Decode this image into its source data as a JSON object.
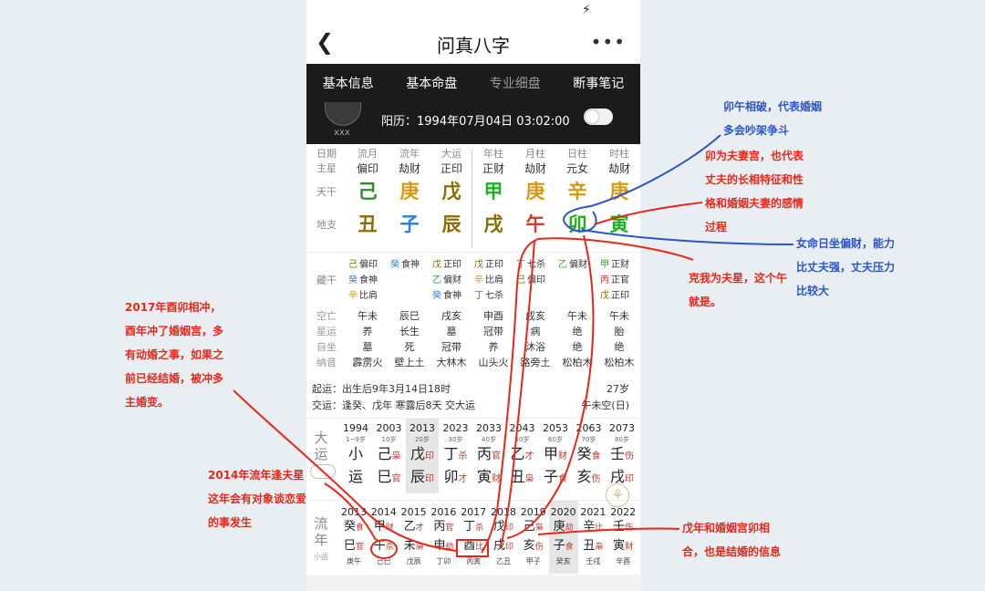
{
  "app": {
    "title": "问真八字",
    "more": "•••"
  },
  "tabs": [
    "基本信息",
    "基本命盘",
    "专业细盘",
    "断事笔记"
  ],
  "header": {
    "name": "xxx",
    "solar": "阳历：1994年07月04日 03:02:00"
  },
  "grid": {
    "row_labels": {
      "r1": "日期",
      "r2": "主星",
      "r3": "天干",
      "r4": "地支"
    },
    "cols": [
      {
        "name": "流月",
        "star": "偏印",
        "gan": "己",
        "zhi": "丑",
        "gc": "#2e8b2e",
        "zc": "#8a6d00"
      },
      {
        "name": "流年",
        "star": "劫财",
        "gan": "庚",
        "zhi": "子",
        "gc": "#d49b12",
        "zc": "#2a7fd4"
      },
      {
        "name": "大运",
        "star": "正印",
        "gan": "戊",
        "zhi": "辰",
        "gc": "#8a6d00",
        "zc": "#8a6d00"
      },
      {
        "name": "年柱",
        "star": "正财",
        "gan": "甲",
        "zhi": "戌",
        "gc": "#1fb01f",
        "zc": "#8a6d00"
      },
      {
        "name": "月柱",
        "star": "劫财",
        "gan": "庚",
        "zhi": "午",
        "gc": "#d49b12",
        "zc": "#d63a2a"
      },
      {
        "name": "日柱",
        "star": "元女",
        "gan": "辛",
        "zhi": "卯",
        "gc": "#d49b12",
        "zc": "#1fb01f"
      },
      {
        "name": "时柱",
        "star": "劫财",
        "gan": "庚",
        "zhi": "寅",
        "gc": "#d49b12",
        "zc": "#1fb01f"
      }
    ]
  },
  "canggan": {
    "label": "藏干",
    "cols": [
      [
        {
          "g": "己",
          "s": "偏印",
          "c": "#8a6d00"
        },
        {
          "g": "癸",
          "s": "食神",
          "c": "#2a7fd4"
        },
        {
          "g": "辛",
          "s": "比肩",
          "c": "#d49b12"
        }
      ],
      [
        {
          "g": "癸",
          "s": "食神",
          "c": "#2a7fd4"
        }
      ],
      [
        {
          "g": "戊",
          "s": "正印",
          "c": "#8a6d00"
        },
        {
          "g": "乙",
          "s": "偏财",
          "c": "#1fb01f"
        },
        {
          "g": "癸",
          "s": "食神",
          "c": "#2a7fd4"
        }
      ],
      [
        {
          "g": "戊",
          "s": "正印",
          "c": "#8a6d00"
        },
        {
          "g": "辛",
          "s": "比肩",
          "c": "#d49b12"
        },
        {
          "g": "丁",
          "s": "七杀",
          "c": "#d63a2a"
        }
      ],
      [
        {
          "g": "丁",
          "s": "七杀",
          "c": "#d63a2a"
        },
        {
          "g": "己",
          "s": "偏印",
          "c": "#8a6d00"
        }
      ],
      [
        {
          "g": "乙",
          "s": "偏财",
          "c": "#1fb01f"
        }
      ],
      [
        {
          "g": "甲",
          "s": "正财",
          "c": "#1fb01f"
        },
        {
          "g": "丙",
          "s": "正官",
          "c": "#d63a2a"
        },
        {
          "g": "戊",
          "s": "正印",
          "c": "#8a6d00"
        }
      ]
    ]
  },
  "yun": {
    "labels": [
      "空亡",
      "星运",
      "自坐",
      "纳音"
    ],
    "cols": [
      [
        "午未",
        "养",
        "墓",
        "霹雳火"
      ],
      [
        "辰巳",
        "长生",
        "死",
        "壁上土"
      ],
      [
        "戌亥",
        "墓",
        "冠带",
        "大林木"
      ],
      [
        "申酉",
        "冠带",
        "养",
        "山头火"
      ],
      [
        "戌亥",
        "病",
        "沐浴",
        "路旁土"
      ],
      [
        "午未",
        "绝",
        "绝",
        "松柏木"
      ],
      [
        "午未",
        "胎",
        "绝",
        "松柏木"
      ]
    ]
  },
  "qiyun": {
    "line1": "起运：出生后9年3月14日18时",
    "age": "27岁",
    "line2": "交运：逢癸、戊年 寒露后8天 交大运",
    "kong": "午未空(日)"
  },
  "dayun": {
    "label": "大运",
    "cols": [
      {
        "y": "1994",
        "a": "1~9岁",
        "t": "小",
        "b": "运",
        "ts": "",
        "bs": ""
      },
      {
        "y": "2003",
        "a": "10岁",
        "t": "己",
        "b": "巳",
        "ts": "枭",
        "bs": "官"
      },
      {
        "y": "2013",
        "a": "20岁",
        "t": "戊",
        "b": "辰",
        "ts": "印",
        "bs": "印"
      },
      {
        "y": "2023",
        "a": "30岁",
        "t": "丁",
        "b": "卯",
        "ts": "杀",
        "bs": "才"
      },
      {
        "y": "2033",
        "a": "40岁",
        "t": "丙",
        "b": "寅",
        "ts": "官",
        "bs": "财"
      },
      {
        "y": "2043",
        "a": "50岁",
        "t": "乙",
        "b": "丑",
        "ts": "才",
        "bs": "枭"
      },
      {
        "y": "2053",
        "a": "60岁",
        "t": "甲",
        "b": "子",
        "ts": "财",
        "bs": "食"
      },
      {
        "y": "2063",
        "a": "70岁",
        "t": "癸",
        "b": "亥",
        "ts": "食",
        "bs": "伤"
      },
      {
        "y": "2073",
        "a": "80岁",
        "t": "壬",
        "b": "戌",
        "ts": "伤",
        "bs": "印"
      }
    ]
  },
  "liunian": {
    "label": "流年",
    "xiao": "小运",
    "cols": [
      {
        "y": "2013",
        "t": "癸",
        "ts": "食",
        "b": "巳",
        "bs": "官",
        "s": "庚午"
      },
      {
        "y": "2014",
        "t": "甲",
        "ts": "财",
        "b": "午",
        "bs": "杀",
        "s": "己巳"
      },
      {
        "y": "2015",
        "t": "乙",
        "ts": "才",
        "b": "未",
        "bs": "枭",
        "s": "戊辰"
      },
      {
        "y": "2016",
        "t": "丙",
        "ts": "官",
        "b": "申",
        "bs": "劫",
        "s": "丁卯"
      },
      {
        "y": "2017",
        "t": "丁",
        "ts": "杀",
        "b": "酉",
        "bs": "比",
        "s": "丙寅"
      },
      {
        "y": "2018",
        "t": "戊",
        "ts": "印",
        "b": "戌",
        "bs": "印",
        "s": "乙丑"
      },
      {
        "y": "2019",
        "t": "己",
        "ts": "枭",
        "b": "亥",
        "bs": "伤",
        "s": "甲子"
      },
      {
        "y": "2020",
        "t": "庚",
        "ts": "劫",
        "b": "子",
        "bs": "食",
        "s": "癸亥"
      },
      {
        "y": "2021",
        "t": "辛",
        "ts": "比",
        "b": "丑",
        "bs": "枭",
        "s": "壬戌"
      },
      {
        "y": "2022",
        "t": "壬",
        "ts": "伤",
        "b": "寅",
        "bs": "财",
        "s": "辛酉"
      }
    ]
  },
  "annotations": {
    "a1": [
      "卯午相破，代表婚姻",
      "多会吵架争斗"
    ],
    "a2": [
      "卯为夫妻宫，也代表",
      "丈夫的长相特征和性",
      "格和婚姻夫妻的感情",
      "过程"
    ],
    "a3": [
      "女命日坐偏财，能力",
      "比丈夫强，丈夫压力",
      "比较大"
    ],
    "a4": [
      "克我为夫星，这个午",
      "就是。"
    ],
    "a5": [
      "2017年酉卯相冲，",
      "酉年冲了婚姻宫，多",
      "有动婚之事，如果之",
      "前已经结婚，被冲多",
      "主婚变。"
    ],
    "a6": [
      "2014年流年逢夫星",
      "这年会有对象谈恋爱",
      "的事发生"
    ],
    "a7": [
      "戊年和婚姻宫卯相",
      "合，也是结婚的信息"
    ]
  }
}
